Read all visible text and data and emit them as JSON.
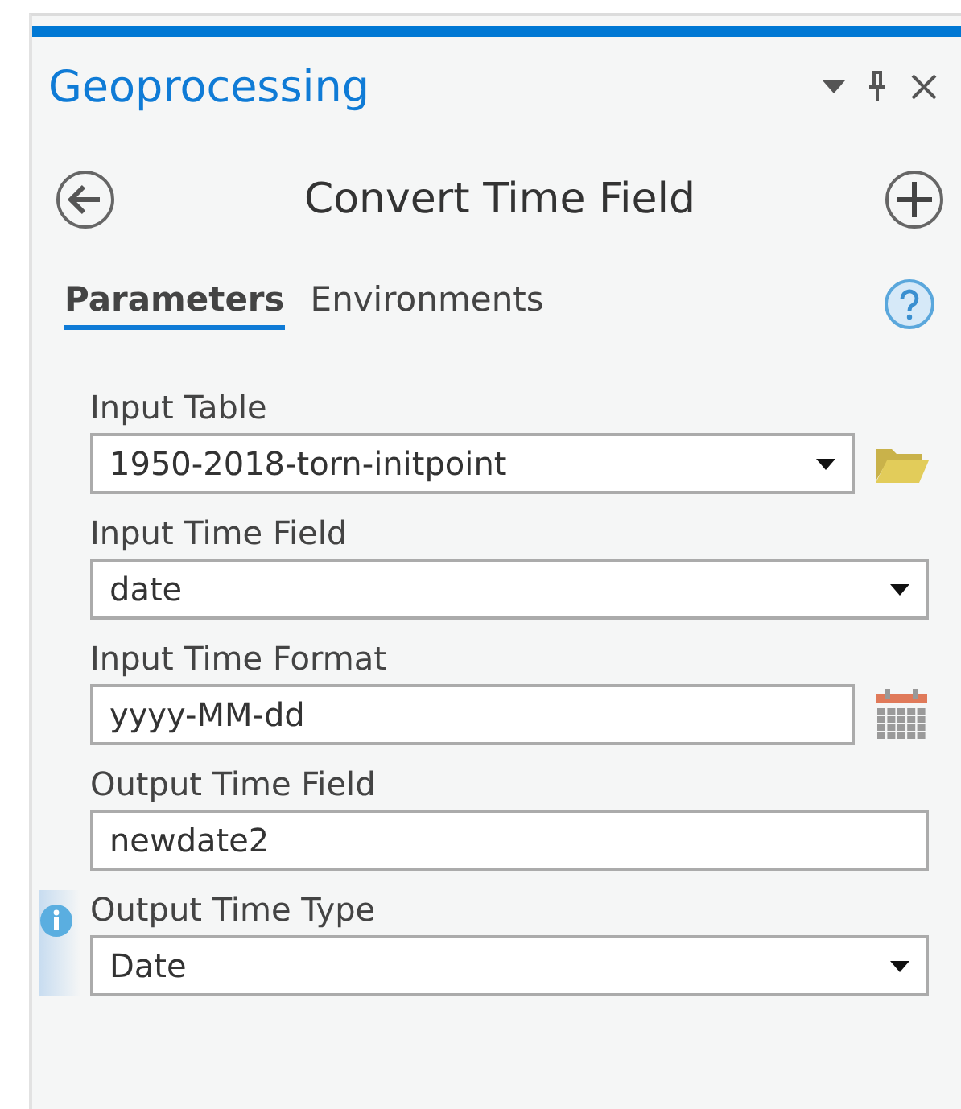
{
  "pane": {
    "title": "Geoprocessing"
  },
  "tool": {
    "title": "Convert Time Field"
  },
  "tabs": [
    {
      "label": "Parameters",
      "selected": true
    },
    {
      "label": "Environments",
      "selected": false
    }
  ],
  "parameters": [
    {
      "label": "Input Table",
      "kind": "dropdown",
      "value": "1950-2018-torn-initpoint",
      "accessory": {
        "kind": "folder"
      },
      "info": false
    },
    {
      "label": "Input Time Field",
      "kind": "dropdown",
      "value": "date",
      "info": false
    },
    {
      "label": "Input Time Format",
      "kind": "text",
      "value": "yyyy-MM-dd",
      "accessory": {
        "kind": "calendar"
      },
      "info": false
    },
    {
      "label": "Output Time Field",
      "kind": "text",
      "value": "newdate2",
      "info": false
    },
    {
      "label": "Output Time Type",
      "kind": "dropdown",
      "value": "Date",
      "info": true
    }
  ]
}
